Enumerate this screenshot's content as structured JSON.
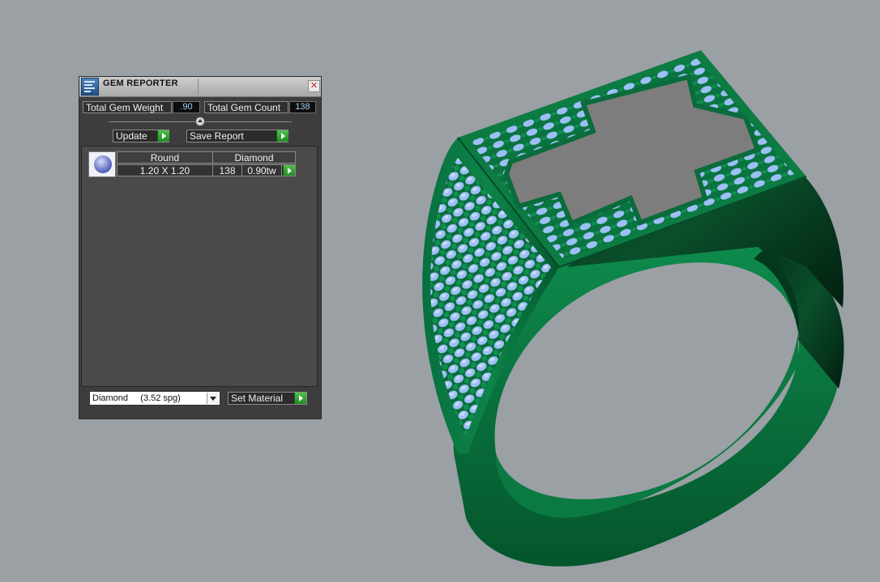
{
  "window": {
    "title": "GEM REPORTER",
    "close_glyph": "✕",
    "icon": "gem-reporter-app-icon"
  },
  "summary": {
    "weight_label": "Total Gem Weight",
    "weight_value": ".90",
    "count_label": "Total Gem Count",
    "count_value": "138"
  },
  "actions": {
    "update_label": "Update",
    "save_label": "Save Report"
  },
  "gem_table": {
    "icon": "round-gem-icon",
    "shape": "Round",
    "material": "Diamond",
    "size": "1.20 X 1.20",
    "count": "138",
    "weight": "0.90tw"
  },
  "footer": {
    "material_select": "Diamond     (3.52 spg)",
    "set_material_label": "Set Material"
  },
  "viewport": {
    "object": "ring-model",
    "metal_color": "#0f7a45",
    "gem_color": "#8fb6f2",
    "table_color": "#7d7d7d",
    "background_color": "#9ba0a5"
  }
}
